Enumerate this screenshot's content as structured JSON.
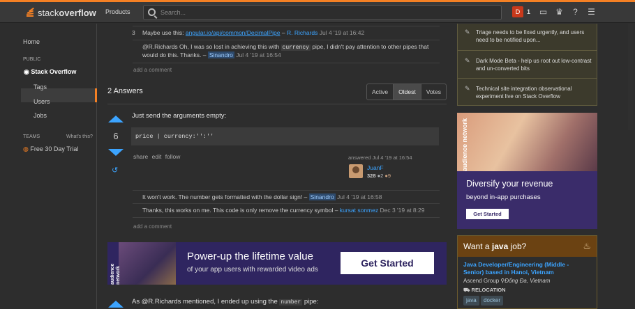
{
  "header": {
    "logo_light": "stack",
    "logo_bold": "overflow",
    "products": "Products",
    "search_placeholder": "Search...",
    "avatar_letter": "D",
    "reputation": "1"
  },
  "leftnav": {
    "home": "Home",
    "public_head": "PUBLIC",
    "stack_overflow": "Stack Overflow",
    "tags": "Tags",
    "users": "Users",
    "jobs": "Jobs",
    "teams_head": "TEAMS",
    "whats_this": "What's this?",
    "free_trial": "Free 30 Day Trial"
  },
  "question_comments": [
    {
      "score": "3",
      "text": "Maybe use this: ",
      "link": "angular.io/api/common/DecimalPipe",
      "dash": " – ",
      "user": "R. Richards",
      "time": " Jul 4 '19 at 16:42"
    },
    {
      "text_a": "@R.Richards Oh, I was so lost in achieving this with ",
      "code": "currency",
      "text_b": " pipe, I didn't pay attention to other pipes that would do this. Thanks. – ",
      "user": "Sinandro",
      "time": " Jul 4 '19 at 16:54"
    }
  ],
  "add_comment": "add a comment",
  "answers_header": "2 Answers",
  "sort_tabs": [
    "Active",
    "Oldest",
    "Votes"
  ],
  "answer": {
    "votes": "6",
    "text": "Just send the arguments empty:",
    "code": "price | currency:'':''",
    "actions": "share edit follow",
    "answered": "answered Jul 4 '19 at 16:54",
    "user": "JuanF",
    "rep": "328",
    "silver": "●2",
    "bronze": "●9"
  },
  "answer_comments": [
    {
      "text": "It won't work. The number gets formatted with the dollar sign! – ",
      "user": "Sinandro",
      "time": " Jul 4 '19 at 16:58"
    },
    {
      "text": "Thanks, this works on me. This code is only remove the currency symbol – ",
      "user": "kursat sonmez",
      "time": " Dec 3 '19 at 8:29"
    }
  ],
  "banner": {
    "network": "audience network",
    "title": "Power-up the lifetime value",
    "subtitle": "of your app users with rewarded video ads",
    "cta": "Get Started"
  },
  "second_answer": {
    "text_a": "As @R.Richards mentioned, I ended up using the ",
    "code": "number",
    "text_b": " pipe:"
  },
  "notices": [
    "Triage needs to be fixed urgently, and users need to be notified upon...",
    "Dark Mode Beta - help us root out low-contrast and un-converted bits",
    "Technical site integration observational experiment live on Stack Overflow"
  ],
  "right_ad": {
    "network": "audience network",
    "title": "Diversify your revenue",
    "subtitle": "beyond in-app purchases",
    "cta": "Get Started"
  },
  "jobs": {
    "header_a": "Want a ",
    "header_b": "java",
    "header_c": " job?",
    "title": "Java Developer/Engineering (Middle - Senior) based in Hanoi, Vietnam",
    "company": "Ascend Group",
    "location": "Đống Đa, Vietnam",
    "relocation": "RELOCATION",
    "tags": [
      "java",
      "docker"
    ]
  },
  "colors": {
    "accent": "#f48024",
    "link": "#3ca4ff",
    "background": "#2d2d2d"
  }
}
